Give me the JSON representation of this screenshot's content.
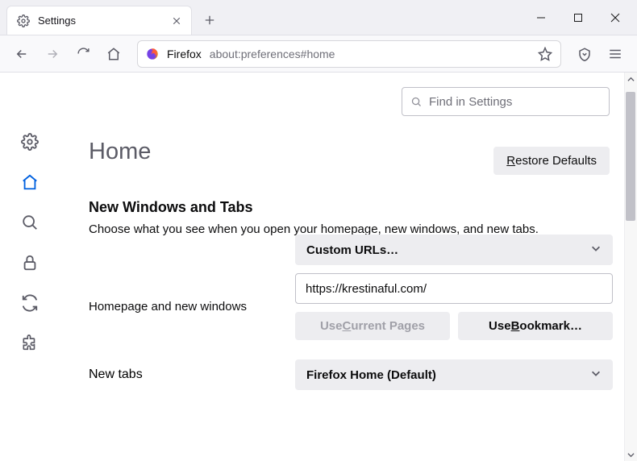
{
  "tab": {
    "title": "Settings"
  },
  "urlbar": {
    "identity": "Firefox",
    "url": "about:preferences#home"
  },
  "search": {
    "placeholder": "Find in Settings"
  },
  "page": {
    "title": "Home"
  },
  "buttons": {
    "restore_pre": "R",
    "restore_post": "estore Defaults",
    "use_current_pre": "Use ",
    "use_current_u": "C",
    "use_current_post": "urrent Pages",
    "use_bookmark_pre": "Use ",
    "use_bookmark_u": "B",
    "use_bookmark_post": "ookmark…"
  },
  "section": {
    "heading": "New Windows and Tabs",
    "desc": "Choose what you see when you open your homepage, new windows, and new tabs."
  },
  "homepage": {
    "label": "Homepage and new windows",
    "select": "Custom URLs…",
    "value": "https://krestinaful.com/"
  },
  "newtabs": {
    "label": "New tabs",
    "select": "Firefox Home (Default)"
  }
}
